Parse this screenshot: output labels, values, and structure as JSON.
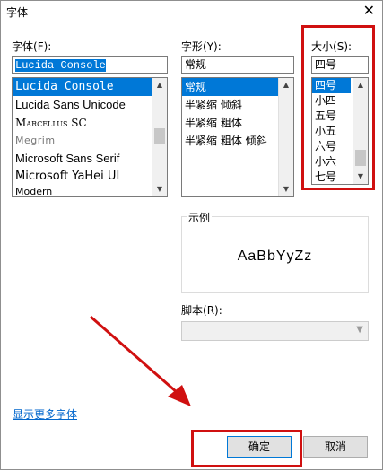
{
  "window": {
    "title": "字体"
  },
  "font": {
    "label": "字体",
    "label_suffix": "(F):",
    "value": "Lucida Console",
    "items": [
      "Lucida Console",
      "Lucida Sans Unicode",
      "Marcellus SC",
      "Megrim",
      "Microsoft Sans Serif",
      "Microsoft YaHei UI",
      "Modern"
    ]
  },
  "style": {
    "label": "字形",
    "label_suffix": "(Y):",
    "value": "常规",
    "items": [
      "常规",
      "半紧缩 倾斜",
      "半紧缩 粗体",
      "半紧缩 粗体 倾斜"
    ]
  },
  "size": {
    "label": "大小",
    "label_suffix": "(S):",
    "value": "四号",
    "items": [
      "四号",
      "小四",
      "五号",
      "小五",
      "六号",
      "小六",
      "七号"
    ]
  },
  "sample": {
    "label": "示例",
    "text": "AaBbYyZz"
  },
  "script": {
    "label": "脚本",
    "label_suffix": "(R):",
    "value": ""
  },
  "more_fonts_link": "显示更多字体",
  "buttons": {
    "ok": "确定",
    "cancel": "取消"
  },
  "colors": {
    "accent": "#0078d7",
    "annotation": "#d01010"
  }
}
